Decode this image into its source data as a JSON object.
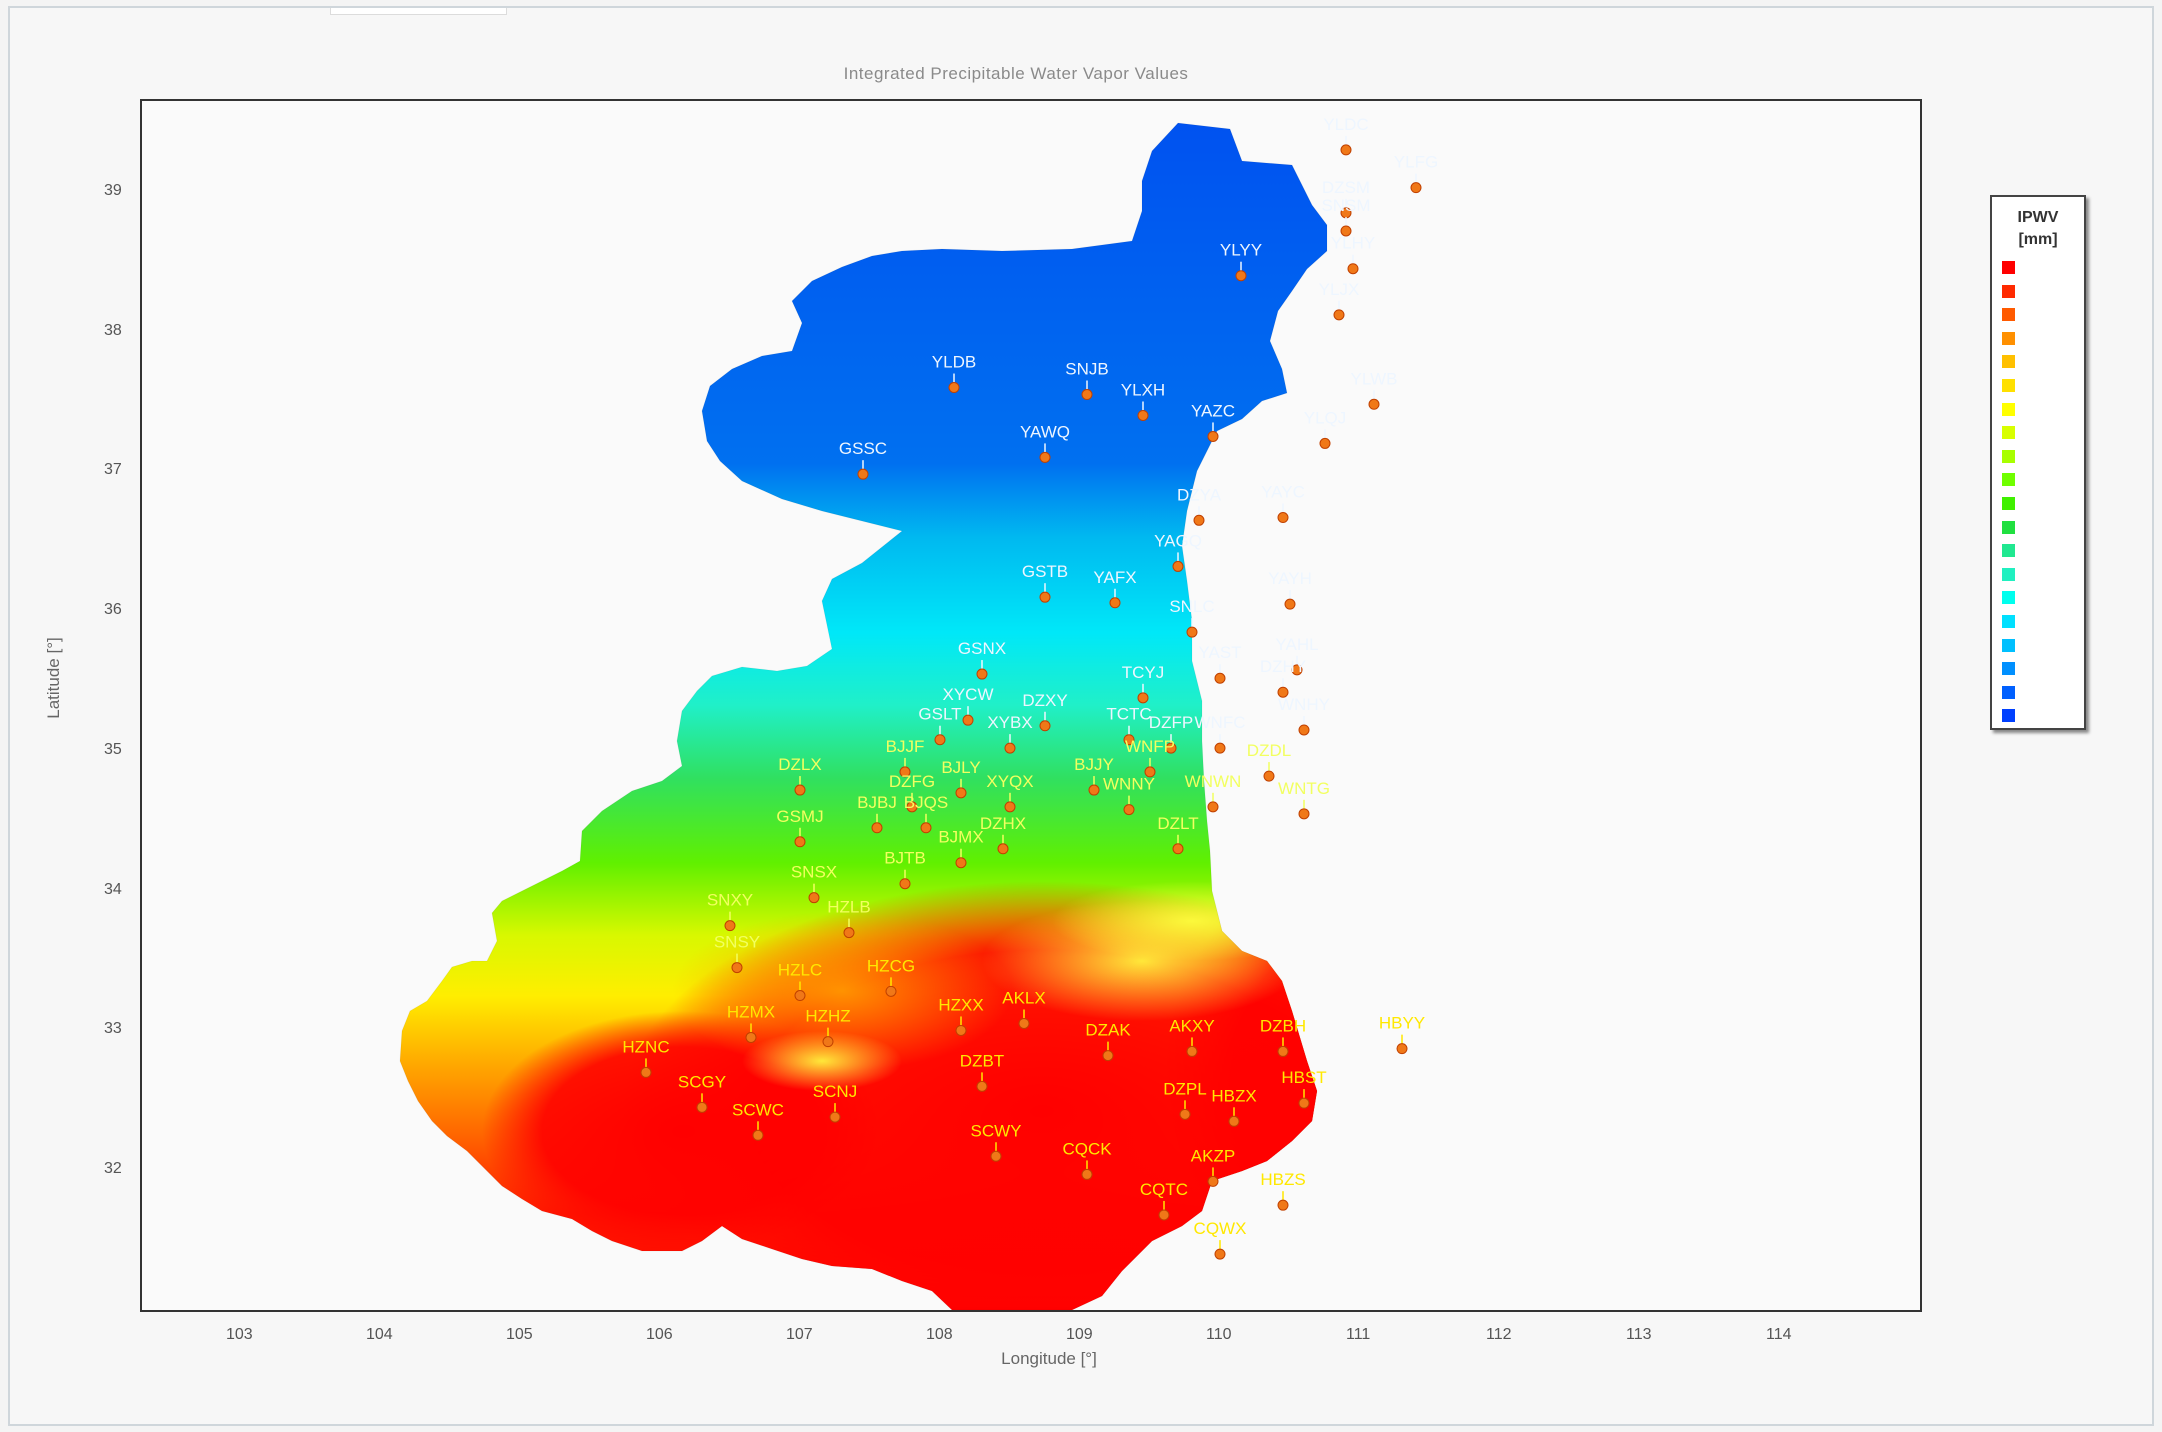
{
  "title": "Integrated Precipitable Water Vapor Values",
  "axes": {
    "x_label": "Longitude [°]",
    "y_label": "Latitude [°]",
    "x_ticks": [
      "103",
      "104",
      "105",
      "106",
      "107",
      "108",
      "109",
      "110",
      "111",
      "112",
      "113",
      "114"
    ],
    "y_ticks": [
      "39",
      "38",
      "37",
      "36",
      "35",
      "34",
      "33",
      "32"
    ],
    "x_range": [
      102.3,
      115.0
    ],
    "y_range": [
      31.0,
      39.65
    ]
  },
  "legend": {
    "title_line1": "IPWV",
    "title_line2": "[mm]",
    "colors": [
      "#ff0000",
      "#ff2a00",
      "#ff5a00",
      "#ff9000",
      "#ffc000",
      "#ffe000",
      "#ffff00",
      "#d8ff00",
      "#a8ff00",
      "#70ff00",
      "#40f000",
      "#20e040",
      "#20e890",
      "#20f0c0",
      "#00ffee",
      "#00e0ff",
      "#00c0ff",
      "#0090ff",
      "#0060ff",
      "#0040ff"
    ]
  },
  "stations": [
    {
      "id": "YLDC",
      "lon": 110.9,
      "lat": 39.3
    },
    {
      "id": "YLFG",
      "lon": 111.4,
      "lat": 39.03
    },
    {
      "id": "DZSM",
      "lon": 110.9,
      "lat": 38.85
    },
    {
      "id": "SNSM",
      "lon": 110.9,
      "lat": 38.72
    },
    {
      "id": "YLHY",
      "lon": 110.95,
      "lat": 38.45
    },
    {
      "id": "YLYY",
      "lon": 110.15,
      "lat": 38.4
    },
    {
      "id": "YLJX",
      "lon": 110.85,
      "lat": 38.12
    },
    {
      "id": "YLDB",
      "lon": 108.1,
      "lat": 37.6
    },
    {
      "id": "SNJB",
      "lon": 109.05,
      "lat": 37.55
    },
    {
      "id": "YLXH",
      "lon": 109.45,
      "lat": 37.4
    },
    {
      "id": "YLWB",
      "lon": 111.1,
      "lat": 37.48
    },
    {
      "id": "YAZC",
      "lon": 109.95,
      "lat": 37.25
    },
    {
      "id": "YLQJ",
      "lon": 110.75,
      "lat": 37.2
    },
    {
      "id": "YAWQ",
      "lon": 108.75,
      "lat": 37.1
    },
    {
      "id": "GSSC",
      "lon": 107.45,
      "lat": 36.98
    },
    {
      "id": "DZYA",
      "lon": 109.85,
      "lat": 36.65
    },
    {
      "id": "YAYC",
      "lon": 110.45,
      "lat": 36.67
    },
    {
      "id": "YAGQ",
      "lon": 109.7,
      "lat": 36.32
    },
    {
      "id": "GSTB",
      "lon": 108.75,
      "lat": 36.1
    },
    {
      "id": "YAFX",
      "lon": 109.25,
      "lat": 36.06
    },
    {
      "id": "YAYH",
      "lon": 110.5,
      "lat": 36.05
    },
    {
      "id": "SNLC",
      "lon": 109.8,
      "lat": 35.85
    },
    {
      "id": "GSNX",
      "lon": 108.3,
      "lat": 35.55
    },
    {
      "id": "YAST",
      "lon": 110.0,
      "lat": 35.52
    },
    {
      "id": "YAHL",
      "lon": 110.55,
      "lat": 35.58
    },
    {
      "id": "TCYJ",
      "lon": 109.45,
      "lat": 35.38
    },
    {
      "id": "DZHY",
      "lon": 110.45,
      "lat": 35.42
    },
    {
      "id": "XYCW",
      "lon": 108.2,
      "lat": 35.22
    },
    {
      "id": "DZXY",
      "lon": 108.75,
      "lat": 35.18
    },
    {
      "id": "WNHY",
      "lon": 110.6,
      "lat": 35.15
    },
    {
      "id": "GSLT",
      "lon": 108.0,
      "lat": 35.08
    },
    {
      "id": "XYBX",
      "lon": 108.5,
      "lat": 35.02
    },
    {
      "id": "TCTC",
      "lon": 109.35,
      "lat": 35.08
    },
    {
      "id": "DZFP",
      "lon": 109.65,
      "lat": 35.02
    },
    {
      "id": "WNFC",
      "lon": 110.0,
      "lat": 35.02
    },
    {
      "id": "BJJF",
      "lon": 107.75,
      "lat": 34.85
    },
    {
      "id": "WNFP",
      "lon": 109.5,
      "lat": 34.85
    },
    {
      "id": "DZDL",
      "lon": 110.35,
      "lat": 34.82
    },
    {
      "id": "DZLX",
      "lon": 107.0,
      "lat": 34.72
    },
    {
      "id": "BJLY",
      "lon": 108.15,
      "lat": 34.7
    },
    {
      "id": "BJJY",
      "lon": 109.1,
      "lat": 34.72
    },
    {
      "id": "DZFG",
      "lon": 107.8,
      "lat": 34.6
    },
    {
      "id": "XYQX",
      "lon": 108.5,
      "lat": 34.6
    },
    {
      "id": "WNNY",
      "lon": 109.35,
      "lat": 34.58
    },
    {
      "id": "WNWN",
      "lon": 109.95,
      "lat": 34.6
    },
    {
      "id": "WNTG",
      "lon": 110.6,
      "lat": 34.55
    },
    {
      "id": "BJBJ",
      "lon": 107.55,
      "lat": 34.45
    },
    {
      "id": "BJQS",
      "lon": 107.9,
      "lat": 34.45
    },
    {
      "id": "GSMJ",
      "lon": 107.0,
      "lat": 34.35
    },
    {
      "id": "DZHX",
      "lon": 108.45,
      "lat": 34.3
    },
    {
      "id": "DZLT",
      "lon": 109.7,
      "lat": 34.3
    },
    {
      "id": "BJMX",
      "lon": 108.15,
      "lat": 34.2
    },
    {
      "id": "BJTB",
      "lon": 107.75,
      "lat": 34.05
    },
    {
      "id": "SNSX",
      "lon": 107.1,
      "lat": 33.95
    },
    {
      "id": "SNXY",
      "lon": 106.5,
      "lat": 33.75
    },
    {
      "id": "HZLB",
      "lon": 107.35,
      "lat": 33.7
    },
    {
      "id": "SNSY",
      "lon": 106.55,
      "lat": 33.45
    },
    {
      "id": "HZLC",
      "lon": 107.0,
      "lat": 33.25
    },
    {
      "id": "HZCG",
      "lon": 107.65,
      "lat": 33.28
    },
    {
      "id": "HZXX",
      "lon": 108.15,
      "lat": 33.0
    },
    {
      "id": "AKLX",
      "lon": 108.6,
      "lat": 33.05
    },
    {
      "id": "DZAK",
      "lon": 109.2,
      "lat": 32.82
    },
    {
      "id": "AKXY",
      "lon": 109.8,
      "lat": 32.85
    },
    {
      "id": "DZBH",
      "lon": 110.45,
      "lat": 32.85
    },
    {
      "id": "HBYY",
      "lon": 111.3,
      "lat": 32.87
    },
    {
      "id": "HZMX",
      "lon": 106.65,
      "lat": 32.95
    },
    {
      "id": "HZHZ",
      "lon": 107.2,
      "lat": 32.92
    },
    {
      "id": "HZNC",
      "lon": 105.9,
      "lat": 32.7
    },
    {
      "id": "DZBT",
      "lon": 108.3,
      "lat": 32.6
    },
    {
      "id": "SCGY",
      "lon": 106.3,
      "lat": 32.45
    },
    {
      "id": "SCNJ",
      "lon": 107.25,
      "lat": 32.38
    },
    {
      "id": "HBST",
      "lon": 110.6,
      "lat": 32.48
    },
    {
      "id": "DZPL",
      "lon": 109.75,
      "lat": 32.4
    },
    {
      "id": "HBZX",
      "lon": 110.1,
      "lat": 32.35
    },
    {
      "id": "SCWC",
      "lon": 106.7,
      "lat": 32.25
    },
    {
      "id": "SCWY",
      "lon": 108.4,
      "lat": 32.1
    },
    {
      "id": "CQCK",
      "lon": 109.05,
      "lat": 31.97
    },
    {
      "id": "AKZP",
      "lon": 109.95,
      "lat": 31.92
    },
    {
      "id": "HBZS",
      "lon": 110.45,
      "lat": 31.75
    },
    {
      "id": "CQTC",
      "lon": 109.6,
      "lat": 31.68
    },
    {
      "id": "CQWX",
      "lon": 110.0,
      "lat": 31.4
    }
  ]
}
